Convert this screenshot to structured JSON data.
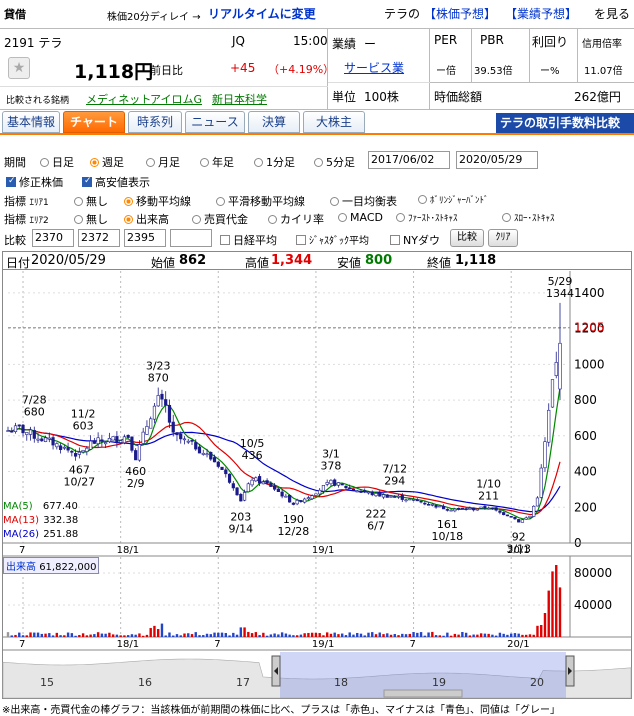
{
  "header": {
    "category": "貸借",
    "delay_note": "株価20分ディレイ →",
    "realtime_link": "リアルタイムに変更",
    "forecast_prefix": "テラの",
    "forecast_price": "【株価予想】",
    "forecast_perf": "【業績予想】",
    "forecast_suffix": "を見る"
  },
  "stock": {
    "code_name": "2191 テラ",
    "market": "JQ",
    "time": "15:00",
    "price": "1,118円",
    "change_label": "前日比",
    "change": "+45",
    "change_pct": "（+4.19%）",
    "compare_label": "比較される銘柄",
    "compare": [
      "メディネット",
      "アイロムG",
      "新日本科学"
    ]
  },
  "info": {
    "perf_label": "業績",
    "perf_value": "ー",
    "sector": "サービス業",
    "unit_label": "単位",
    "unit_value": "100株",
    "per_label": "PER",
    "per_value": "ー倍",
    "pbr_label": "PBR",
    "pbr_value": "39.53倍",
    "yield_label": "利回り",
    "yield_value": "ー%",
    "margin_label": "信用倍率",
    "margin_value": "11.07倍",
    "mcap_label": "時価総額",
    "mcap_value": "262億円"
  },
  "tabs": [
    "基本情報",
    "チャート",
    "時系列",
    "ニュース",
    "決算",
    "大株主"
  ],
  "fee_banner": "テラの取引手数料比較",
  "controls": {
    "period_label": "期間",
    "periods": [
      "日足",
      "週足",
      "月足",
      "年足",
      "1分足",
      "5分足"
    ],
    "date_from": "2017/06/02",
    "date_to": "2020/05/29",
    "check1": "修正株価",
    "check2": "高安値表示",
    "ind1_label": "指標",
    "area1": "ｴﾘｱ1",
    "ind1_opts": [
      "無し",
      "移動平均線",
      "平滑移動平均線",
      "一目均衡表",
      "ﾎﾞﾘﾝｼﾞｬｰﾊﾞﾝﾄﾞ"
    ],
    "ind2_label": "指標",
    "area2": "ｴﾘｱ2",
    "ind2_opts": [
      "無し",
      "出来高",
      "売買代金",
      "カイリ率",
      "MACD",
      "ﾌｧｰｽﾄ･ｽﾄｷｬｽ",
      "ｽﾛｰ･ｽﾄｷｬｽ"
    ],
    "compare_label": "比較",
    "cmp1": "2370",
    "cmp2": "2372",
    "cmp3": "2395",
    "cmp4": "",
    "nikkei": "日経平均",
    "jasdaq": "ｼﾞｬｽﾀﾞｯｸ平均",
    "nydow": "NYダウ",
    "compare_btn": "比較",
    "clear_btn": "ｸﾘｱ"
  },
  "ohlc": {
    "date_label": "日付",
    "date": "2020/05/29",
    "open_label": "始値",
    "open": "862",
    "high_label": "高値",
    "high": "1,344",
    "low_label": "安値",
    "low": "800",
    "close_label": "終値",
    "close": "1,118"
  },
  "ma_legend": [
    {
      "label": "MA(5)",
      "value": "677.40",
      "color": "#008800"
    },
    {
      "label": "MA(13)",
      "value": "332.38",
      "color": "#e00000"
    },
    {
      "label": "MA(26)",
      "value": "251.88",
      "color": "#0000cc"
    }
  ],
  "volume_label": "出来高",
  "volume_value": "61,822,000",
  "footer_note": "※出来高・売買代金の棒グラフ：当該株価が前期間の株価に比べ、プラスは「赤色」、マイナスは「青色」、同値は「グレー」",
  "chart_data": {
    "type": "candlestick",
    "ylim": [
      0,
      1500
    ],
    "yticks": [
      0,
      200,
      400,
      600,
      800,
      1000,
      1200,
      1400
    ],
    "ref_line": 1205,
    "x_labels": [
      {
        "i": 4,
        "t": "7"
      },
      {
        "i": 30,
        "t": "18/1"
      },
      {
        "i": 56,
        "t": "7"
      },
      {
        "i": 82,
        "t": "19/1"
      },
      {
        "i": 108,
        "t": "7"
      },
      {
        "i": 134,
        "t": "20/1"
      }
    ],
    "annotations": [
      {
        "i": 7,
        "v": 680,
        "text": "7/28\n680",
        "pos": "above"
      },
      {
        "i": 20,
        "v": 603,
        "text": "11/2\n603",
        "pos": "above"
      },
      {
        "i": 19,
        "v": 467,
        "text": "467\n10/27",
        "pos": "below"
      },
      {
        "i": 34,
        "v": 460,
        "text": "460\n2/9",
        "pos": "below"
      },
      {
        "i": 40,
        "v": 870,
        "text": "3/23\n870",
        "pos": "above"
      },
      {
        "i": 65,
        "v": 436,
        "text": "10/5\n436",
        "pos": "above"
      },
      {
        "i": 62,
        "v": 203,
        "text": "203\n9/14",
        "pos": "below"
      },
      {
        "i": 76,
        "v": 190,
        "text": "190\n12/28",
        "pos": "below"
      },
      {
        "i": 86,
        "v": 378,
        "text": "3/1\n378",
        "pos": "above"
      },
      {
        "i": 98,
        "v": 222,
        "text": "222\n6/7",
        "pos": "below"
      },
      {
        "i": 103,
        "v": 294,
        "text": "7/12\n294",
        "pos": "above"
      },
      {
        "i": 117,
        "v": 161,
        "text": "161\n10/18",
        "pos": "below"
      },
      {
        "i": 128,
        "v": 211,
        "text": "1/10\n211",
        "pos": "above"
      },
      {
        "i": 136,
        "v": 92,
        "text": "92\n3/13",
        "pos": "below"
      },
      {
        "i": 147,
        "v": 1344,
        "text": "5/29\n1344",
        "pos": "above"
      }
    ],
    "vol_yticks": [
      40000,
      80000
    ],
    "vol_ymax": 100000,
    "minimap_labels": [
      "15",
      "16",
      "17",
      "18",
      "19",
      "20"
    ],
    "colors": {
      "up": "#ffffff",
      "down": "#1a1a8a",
      "ma5": "#008800",
      "ma13": "#e00000",
      "ma26": "#0000cc",
      "vol_up": "#e00000",
      "vol_down": "#2244cc",
      "vol_flat": "#999999"
    }
  }
}
